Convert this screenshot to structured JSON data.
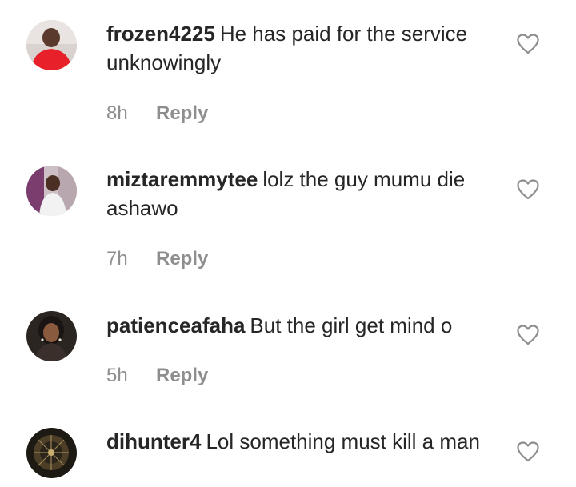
{
  "comments": [
    {
      "username": "frozen4225",
      "text": "He has paid for the service unknowingly",
      "time": "8h",
      "reply_label": "Reply"
    },
    {
      "username": "miztaremmytee",
      "text": "lolz the guy mumu die ashawo",
      "time": "7h",
      "reply_label": "Reply"
    },
    {
      "username": "patienceafaha",
      "text": "But the girl get mind o",
      "time": "5h",
      "reply_label": "Reply"
    },
    {
      "username": "dihunter4",
      "text": "Lol something must kill a man"
    }
  ],
  "colors": {
    "text": "#262626",
    "muted": "#8e8e8e",
    "heart_outline": "#8e8e8e"
  }
}
